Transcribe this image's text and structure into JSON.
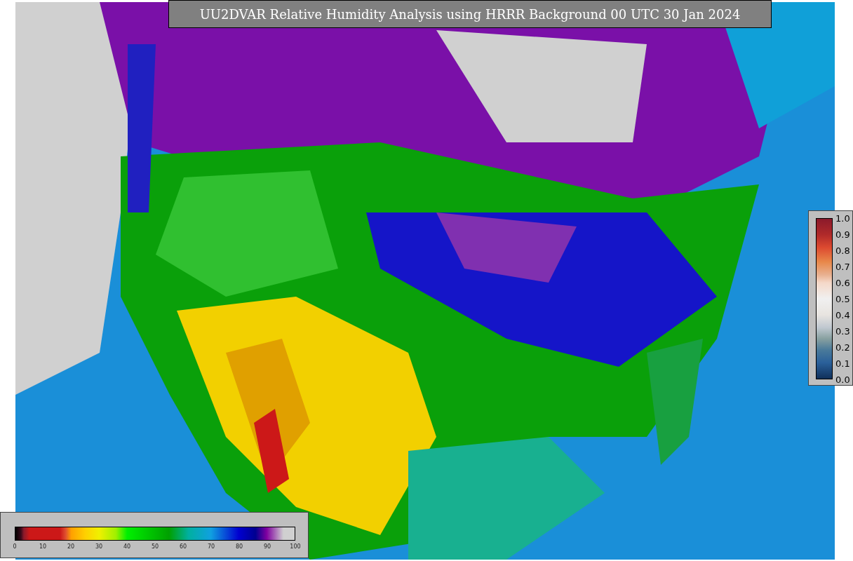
{
  "title": "UU2DVAR Relative Humidity Analysis using HRRR Background 00 UTC 30 Jan 2024",
  "colorbar_bottom": {
    "labels": [
      "0",
      "10",
      "20",
      "30",
      "40",
      "50",
      "60",
      "70",
      "80",
      "90",
      "100"
    ]
  },
  "colorbar_right": {
    "labels": [
      "1.0",
      "0.9",
      "0.8",
      "0.7",
      "0.6",
      "0.5",
      "0.4",
      "0.3",
      "0.2",
      "0.1",
      "0.0"
    ]
  }
}
